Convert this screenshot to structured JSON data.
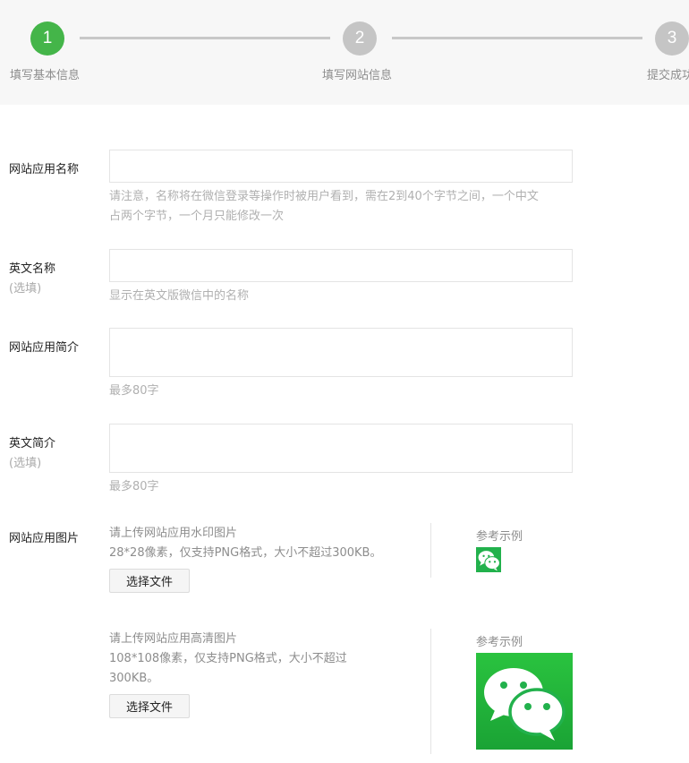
{
  "steps": [
    {
      "number": "1",
      "label": "填写基本信息",
      "state": "active"
    },
    {
      "number": "2",
      "label": "填写网站信息",
      "state": "inactive"
    },
    {
      "number": "3",
      "label": "提交成功",
      "state": "inactive"
    }
  ],
  "colors": {
    "active_step": "#44b549",
    "inactive_step": "#c5c5c5",
    "wechat_green": "#22b14c"
  },
  "form": {
    "app_name": {
      "label": "网站应用名称",
      "value": "",
      "hint_line1": "请注意，名称将在微信登录等操作时被用户看到，需在2到40个字节之间，一个中文",
      "hint_line2": "占两个字节，一个月只能修改一次"
    },
    "english_name": {
      "label": "英文名称",
      "optional": "(选填)",
      "value": "",
      "hint": "显示在英文版微信中的名称"
    },
    "app_intro": {
      "label": "网站应用简介",
      "value": "",
      "hint": "最多80字"
    },
    "english_intro": {
      "label": "英文简介",
      "optional": "(选填)",
      "value": "",
      "hint": "最多80字"
    },
    "app_image": {
      "label": "网站应用图片",
      "watermark": {
        "title": "请上传网站应用水印图片",
        "spec": "28*28像素，仅支持PNG格式，大小不超过300KB。",
        "button": "选择文件",
        "ref_label": "参考示例",
        "ref_icon": "wechat-logo-icon"
      },
      "hd": {
        "title": "请上传网站应用高清图片",
        "spec_line1": "108*108像素，仅支持PNG格式，大小不超过",
        "spec_line2": "300KB。",
        "button": "选择文件",
        "ref_label": "参考示例",
        "ref_icon": "wechat-logo-icon"
      }
    }
  }
}
